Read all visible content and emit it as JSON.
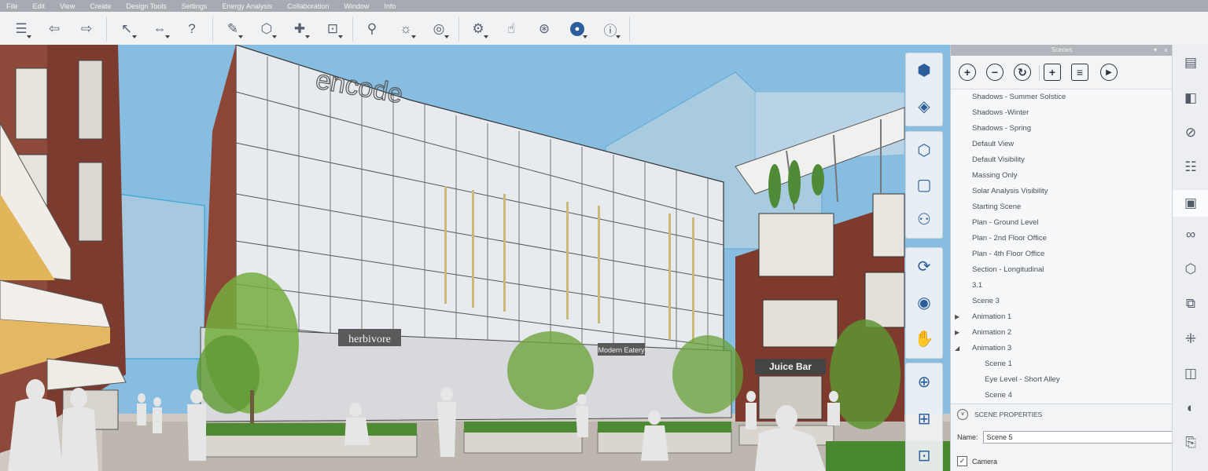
{
  "menu": [
    "File",
    "Edit",
    "View",
    "Create",
    "Design Tools",
    "Settings",
    "Energy Analysis",
    "Collaboration",
    "Window",
    "Info"
  ],
  "toolbar": {
    "icons": [
      "menu-icon",
      "undo-icon",
      "redo-icon",
      "select-icon",
      "measure-icon",
      "help-icon",
      "draw-icon",
      "shape-icon",
      "paint-icon",
      "group-icon",
      "pin-icon",
      "sun-icon",
      "speed-icon",
      "settings-icon",
      "hand-icon",
      "share-icon",
      "user-icon",
      "info-icon"
    ]
  },
  "viewport": {
    "sign_encode": "encode",
    "sign_herbivore": "herbivore",
    "sign_modern": "Modern Eatery",
    "sign_juice": "Juice Bar"
  },
  "panel": {
    "title": "Scenes",
    "pin": "▾",
    "close": "×",
    "tools": [
      "+",
      "−",
      "↻",
      "+",
      "≡",
      "▶"
    ],
    "scenes": [
      {
        "label": "Shadows - Summer Solstice",
        "indent": 0,
        "twisty": ""
      },
      {
        "label": "Shadows -Winter",
        "indent": 0,
        "twisty": ""
      },
      {
        "label": "Shadows - Spring",
        "indent": 0,
        "twisty": ""
      },
      {
        "label": "Default View",
        "indent": 0,
        "twisty": ""
      },
      {
        "label": "Default Visibility",
        "indent": 0,
        "twisty": ""
      },
      {
        "label": "Massing Only",
        "indent": 0,
        "twisty": ""
      },
      {
        "label": "Solar Analysis Visibility",
        "indent": 0,
        "twisty": ""
      },
      {
        "label": "Starting Scene",
        "indent": 0,
        "twisty": ""
      },
      {
        "label": "Plan - Ground Level",
        "indent": 0,
        "twisty": ""
      },
      {
        "label": "Plan - 2nd Floor Office",
        "indent": 0,
        "twisty": ""
      },
      {
        "label": "Plan - 4th Floor Office",
        "indent": 0,
        "twisty": ""
      },
      {
        "label": "Section - Longitudinal",
        "indent": 0,
        "twisty": ""
      },
      {
        "label": "3.1",
        "indent": 0,
        "twisty": ""
      },
      {
        "label": "Scene 3",
        "indent": 0,
        "twisty": ""
      },
      {
        "label": "Animation 1",
        "indent": 0,
        "twisty": "▶"
      },
      {
        "label": "Animation 2",
        "indent": 0,
        "twisty": "▶"
      },
      {
        "label": "Animation 3",
        "indent": 0,
        "twisty": "◢"
      },
      {
        "label": "Scene 1",
        "indent": 1,
        "twisty": ""
      },
      {
        "label": "Eye Level - Short Alley",
        "indent": 1,
        "twisty": ""
      },
      {
        "label": "Scene 4",
        "indent": 1,
        "twisty": ""
      }
    ],
    "props_title": "SCENE PROPERTIES",
    "props_chevron": "∨",
    "name_label": "Name:",
    "name_value": "Scene 5",
    "camera_label": "Camera",
    "camera_checked": "✓"
  },
  "colors": {
    "sky": "#86bde0",
    "brick": "#7a3a2e",
    "glass": "#dfe3e8",
    "tree": "#6aa23a",
    "accent": "#2d5e9c"
  }
}
